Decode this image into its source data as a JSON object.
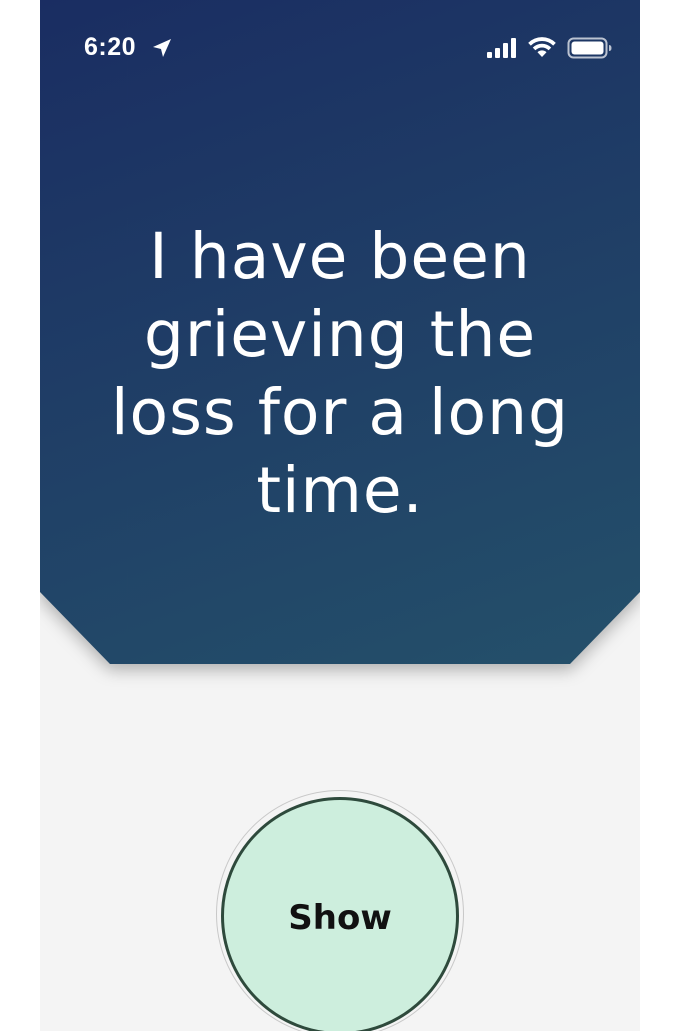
{
  "status_bar": {
    "time": "6:20",
    "location_icon": "location-arrow-icon",
    "signal_icon": "cellular-signal-icon",
    "wifi_icon": "wifi-icon",
    "battery_icon": "battery-icon"
  },
  "card": {
    "quote": "I have been grieving the loss for a long time.",
    "gradient_colors": [
      "#1a2d62",
      "#24506a"
    ],
    "text_color": "#ffffff"
  },
  "show_button": {
    "label": "Show",
    "fill_color": "#cdeedd",
    "border_color": "#2e4a3c"
  },
  "background_color": "#f4f4f4"
}
